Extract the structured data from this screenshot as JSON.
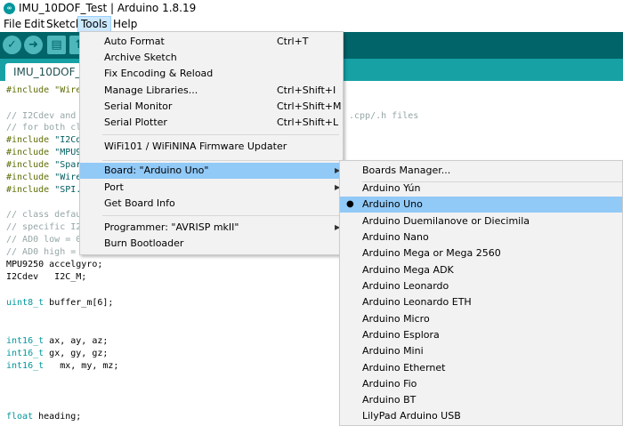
{
  "window": {
    "title": "IMU_10DOF_Test | Arduino 1.8.19",
    "logo": "arduino-infinity-icon"
  },
  "menubar": [
    {
      "id": "file",
      "label": "File"
    },
    {
      "id": "edit",
      "label": "Edit"
    },
    {
      "id": "sketch",
      "label": "Sketch"
    },
    {
      "id": "tools",
      "label": "Tools"
    },
    {
      "id": "help",
      "label": "Help"
    }
  ],
  "toolbar": {
    "verify_glyph": "✓",
    "upload_glyph": "➜",
    "new_glyph": "▤",
    "open_glyph": "↑"
  },
  "tab": {
    "label": "IMU_10DOF_Te"
  },
  "code": {
    "l1": "#include \"Wire",
    "l2": "// I2Cdev and",
    "l2r": ".cpp/.h files",
    "l3": "// for both cl",
    "l4a": "#include ",
    "l4b": "\"I2Cd",
    "l5a": "#include ",
    "l5b": "\"MPU9",
    "l6a": "#include ",
    "l6b": "\"Spar",
    "l7a": "#include ",
    "l7b": "\"Wire",
    "l8a": "#include ",
    "l8b": "\"SPI.",
    "l9": "// class defau",
    "l10": "// specific I2",
    "l11": "// AD0 low = 0",
    "l12": "// AD0 high = 0x69",
    "l13": "MPU9250 accelgyro;",
    "l14": "I2Cdev   I2C_M;",
    "l15a": "uint8_t",
    "l15b": " buffer_m[6];",
    "l16a": "int16_t",
    "l16b": " ax, ay, az;",
    "l17a": "int16_t",
    "l17b": " gx, gy, gz;",
    "l18a": "int16_t",
    "l18b": "   mx, my, mz;",
    "l19a": "float",
    "l19b": " heading;"
  },
  "tools_menu": {
    "auto_format": {
      "label": "Auto Format",
      "shortcut": "Ctrl+T"
    },
    "archive": {
      "label": "Archive Sketch"
    },
    "fix_encoding": {
      "label": "Fix Encoding & Reload"
    },
    "manage_libs": {
      "label": "Manage Libraries...",
      "shortcut": "Ctrl+Shift+I"
    },
    "serial_monitor": {
      "label": "Serial Monitor",
      "shortcut": "Ctrl+Shift+M"
    },
    "serial_plotter": {
      "label": "Serial Plotter",
      "shortcut": "Ctrl+Shift+L"
    },
    "wifi_updater": {
      "label": "WiFi101 / WiFiNINA Firmware Updater"
    },
    "board": {
      "label": "Board: \"Arduino Uno\""
    },
    "port": {
      "label": "Port"
    },
    "board_info": {
      "label": "Get Board Info"
    },
    "programmer": {
      "label": "Programmer: \"AVRISP mkII\""
    },
    "burn_bootloader": {
      "label": "Burn Bootloader"
    },
    "arrow": "▶"
  },
  "board_submenu": {
    "manager": "Boards Manager...",
    "selected_bullet": "●",
    "boards": [
      "Arduino Yún",
      "Arduino Uno",
      "Arduino Duemilanove or Diecimila",
      "Arduino Nano",
      "Arduino Mega or Mega 2560",
      "Arduino Mega ADK",
      "Arduino Leonardo",
      "Arduino Leonardo ETH",
      "Arduino Micro",
      "Arduino Esplora",
      "Arduino Mini",
      "Arduino Ethernet",
      "Arduino Fio",
      "Arduino BT",
      "LilyPad Arduino USB"
    ]
  },
  "colors": {
    "toolbar": "#006468",
    "tabstrip": "#17a1a5",
    "highlight": "#91c9f7"
  }
}
